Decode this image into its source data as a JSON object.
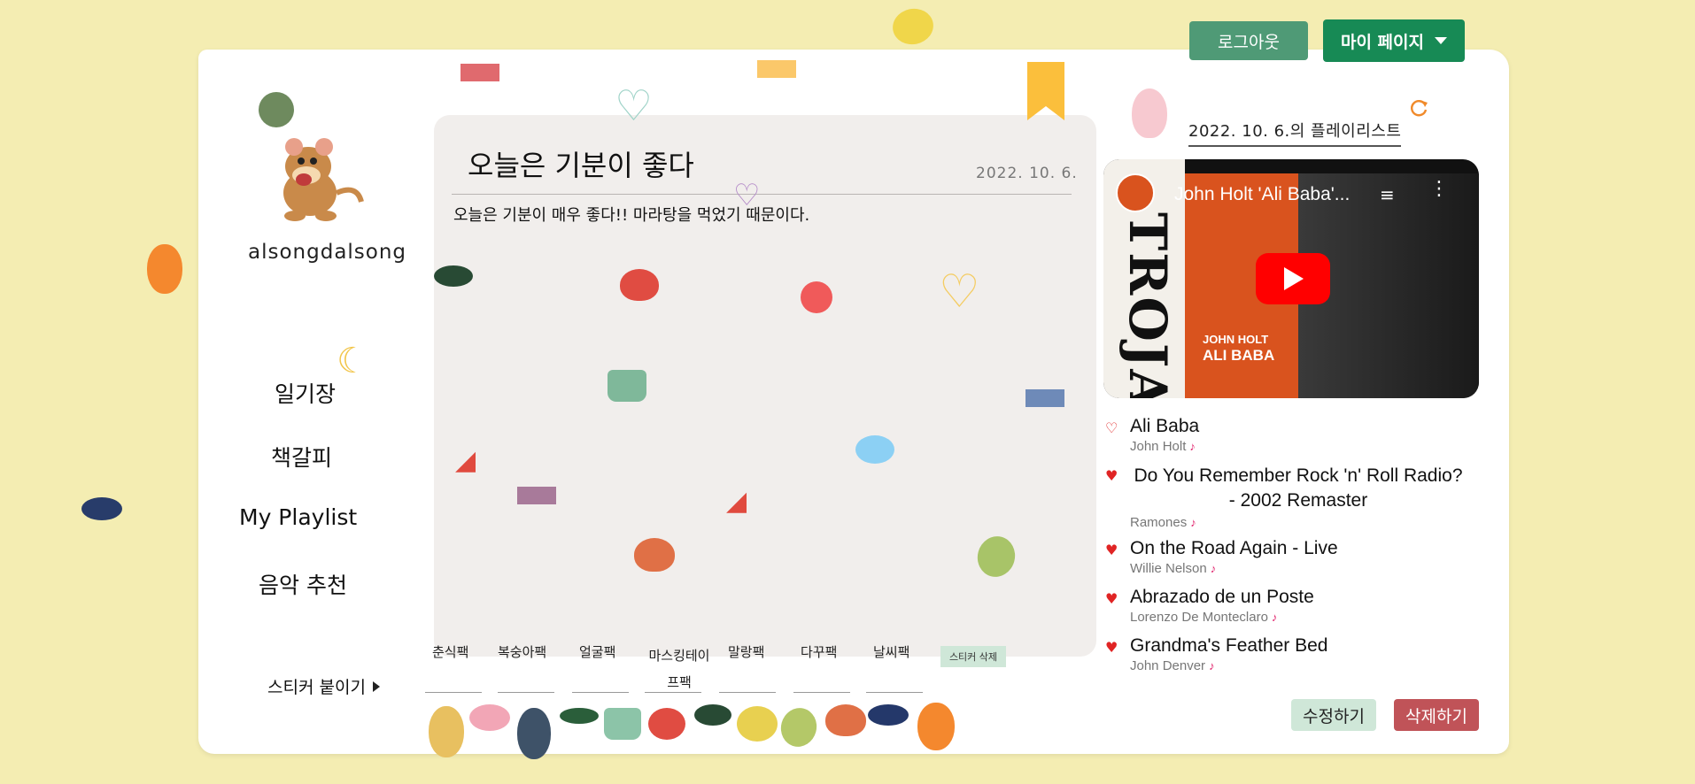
{
  "header": {
    "logout_label": "로그아웃",
    "mypage_label": "마이 페이지"
  },
  "profile": {
    "username": "alsongdalsong"
  },
  "nav": {
    "items": [
      "일기장",
      "책갈피",
      "My Playlist",
      "음악 추천"
    ],
    "sticker_label": "스티커 붙이기"
  },
  "diary": {
    "title": "오늘은 기분이 좋다",
    "date": "2022. 10. 6.",
    "body": "오늘은 기분이 매우 좋다!! 마라탕을 먹었기 때문이다."
  },
  "sticker_packs": {
    "tabs": [
      "춘식팩",
      "복숭아팩",
      "얼굴팩",
      "마스킹테이프팩",
      "말랑팩",
      "다꾸팩",
      "날씨팩"
    ],
    "delete_label": "스티커 삭제"
  },
  "playlist": {
    "date_title": "2022. 10. 6.의 플레이리스트",
    "video": {
      "title": "John Holt 'Ali Baba'...",
      "artist_text": "JOHN HOLT",
      "song_text": "ALI BABA",
      "label_text": "TROJAN"
    },
    "songs": [
      {
        "title": "Ali Baba",
        "artist": "John Holt",
        "liked": false
      },
      {
        "title": "Do You Remember Rock 'n' Roll Radio? - 2002 Remaster",
        "artist": "Ramones",
        "liked": true
      },
      {
        "title": "On the Road Again - Live",
        "artist": "Willie Nelson",
        "liked": true
      },
      {
        "title": "Abrazado de un Poste",
        "artist": "Lorenzo De Monteclaro",
        "liked": true
      },
      {
        "title": "Grandma's Feather Bed",
        "artist": "John Denver",
        "liked": true
      }
    ],
    "edit_label": "수정하기",
    "delete_label": "삭제하기"
  },
  "colors": {
    "background": "#f4edb2",
    "logout": "#4f9a76",
    "mypage": "#178a55",
    "delete": "#c05358",
    "heart": "#e02424"
  },
  "icons": {
    "refresh": "refresh-icon",
    "dropdown": "caret-down-icon",
    "note": "music-note-icon",
    "heart": "heart-icon",
    "bookmark": "bookmark-icon",
    "play": "play-icon"
  }
}
